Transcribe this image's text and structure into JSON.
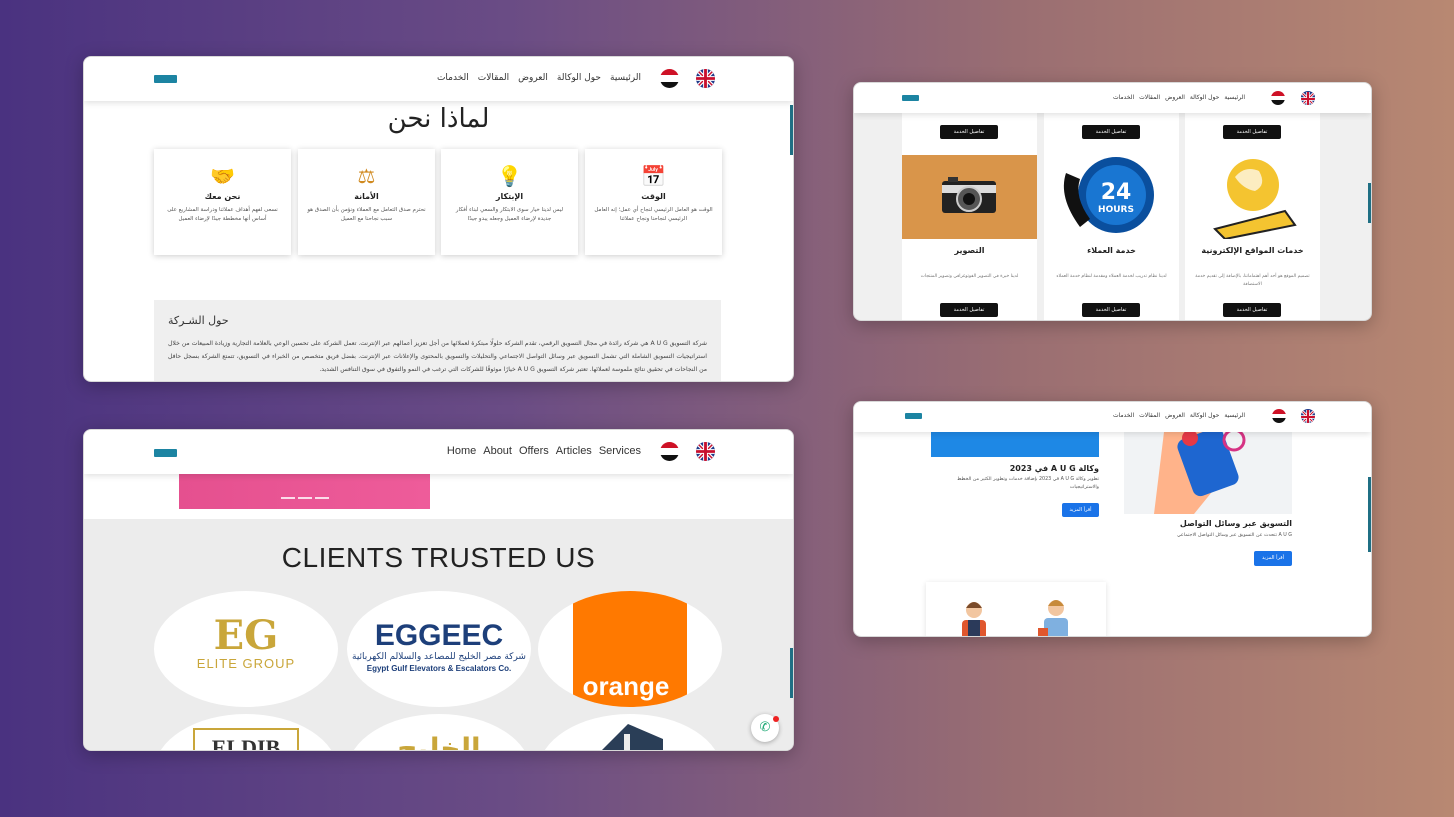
{
  "nav_ar": {
    "items": [
      "الرئيسية",
      "حول الوكالة",
      "العروض",
      "المقالات",
      "الخدمات"
    ]
  },
  "nav_en": {
    "items": [
      "Home",
      "About",
      "Offers",
      "Articles",
      "Services"
    ]
  },
  "why": {
    "title": "لماذا نحن",
    "cards": [
      {
        "title": "الوقت",
        "icon": "calendar-clock-icon",
        "text": "الوقت هو العامل الرئيسي لنجاح أي عمل؛ إنه العامل الرئيسي لنجاحنا ونجاح عملائنا"
      },
      {
        "title": "الإبتكار",
        "icon": "lightbulb-gears-icon",
        "text": "ليس لدينا خيار سوى الابتكار والسعي لبناء أفكار جديدة لإرضاء العميل وجعله يبدو جيدًا"
      },
      {
        "title": "الأمانة",
        "icon": "scales-icon",
        "text": "نحترم صدق التعامل مع العملاء ونؤمن بأن الصدق هو سبب نجاحنا مع العميل"
      },
      {
        "title": "نحن معك",
        "icon": "handshake-icon",
        "text": "نسعى لفهم أهداف عملائنا ودراسة المشاريع على أساس أنها مخططة جيدًا لإرضاء العميل"
      }
    ]
  },
  "about": {
    "title": "حول الشـركة",
    "text": "شركة التسويق A U G هي شركة رائدة في مجال التسويق الرقمي، تقدم الشركة حلولًا مبتكرة لعملائها من أجل تعزيز أعمالهم عبر الإنترنت. تعمل الشركة على تحسين الوعي بالعلامة التجارية وزيادة المبيعات من خلال استراتيجيات التسويق الشاملة التي تشمل التسويق عبر وسائل التواصل الاجتماعي والتحليلات والتسويق بالمحتوى والإعلانات عبر الإنترنت. بفضل فريق متخصص من الخبراء في التسويق، تتمتع الشركة بسجل حافل من النجاحات في تحقيق نتائج ملموسة لعملائها. تعتبر شركة التسويق A U G خيارًا موثوقًا للشركات التي ترغب في النمو والتفوق في سوق التنافس الشديد."
  },
  "services": {
    "button": "تفاصيل الخدمة",
    "items": [
      {
        "title": "التصوير",
        "image": "camera-icon",
        "desc": "لدينا خبرة في التصوير الفوتوغرافي وتصوير المنتجات"
      },
      {
        "title": "خدمة العملاء",
        "image": "24-hours-phone-icon",
        "desc": "لدينا نظام تدريب لخدمة العملاء ومقدمة لنظام خدمة العملاء"
      },
      {
        "title": "خدمات المواقع الإلكترونية",
        "image": "globe-tablet-icon",
        "desc": "تصميم الموقع هو أحد أهم اهتماماتنا، بالإضافة إلى تقديم خدمة الاستضافة"
      }
    ]
  },
  "clients": {
    "title": "CLIENTS TRUSTED US",
    "logos": [
      {
        "name": "ELITE GROUP",
        "mark": "EG"
      },
      {
        "name": "Egypt Gulf Elevators & Escalators Co.",
        "mark": "EGGEEC",
        "arabic": "شركة مصر الخليج للمصاعد والسلالم الكهربائية"
      },
      {
        "name": "orange",
        "mark": "orange"
      },
      {
        "name": "ELDIB",
        "mark": "ELDIB"
      },
      {
        "name": "الخليج",
        "mark": "الخليج"
      },
      {
        "name": "building-logo",
        "mark": ""
      }
    ]
  },
  "articles": {
    "left": {
      "title": "وكالة A U G في 2023",
      "desc": "تطوير وكالة A U G في 2023 بإضافة خدمات وتطوير الكثير من الخطط والاستراتيجيات",
      "button": "أقرأ المزيد"
    },
    "right": {
      "title": "التسويق عبر وسائل التواصل",
      "desc": "A U G تتحدث عن التسويق عبر وسائل التواصل الاجتماعي",
      "button": "أقرأ المزيد"
    }
  },
  "colors": {
    "accent": "#1c84a2",
    "dark_button": "#111111",
    "blue_button": "#1a73e8",
    "pink": "#e5508f",
    "orange": "#ff7900"
  }
}
